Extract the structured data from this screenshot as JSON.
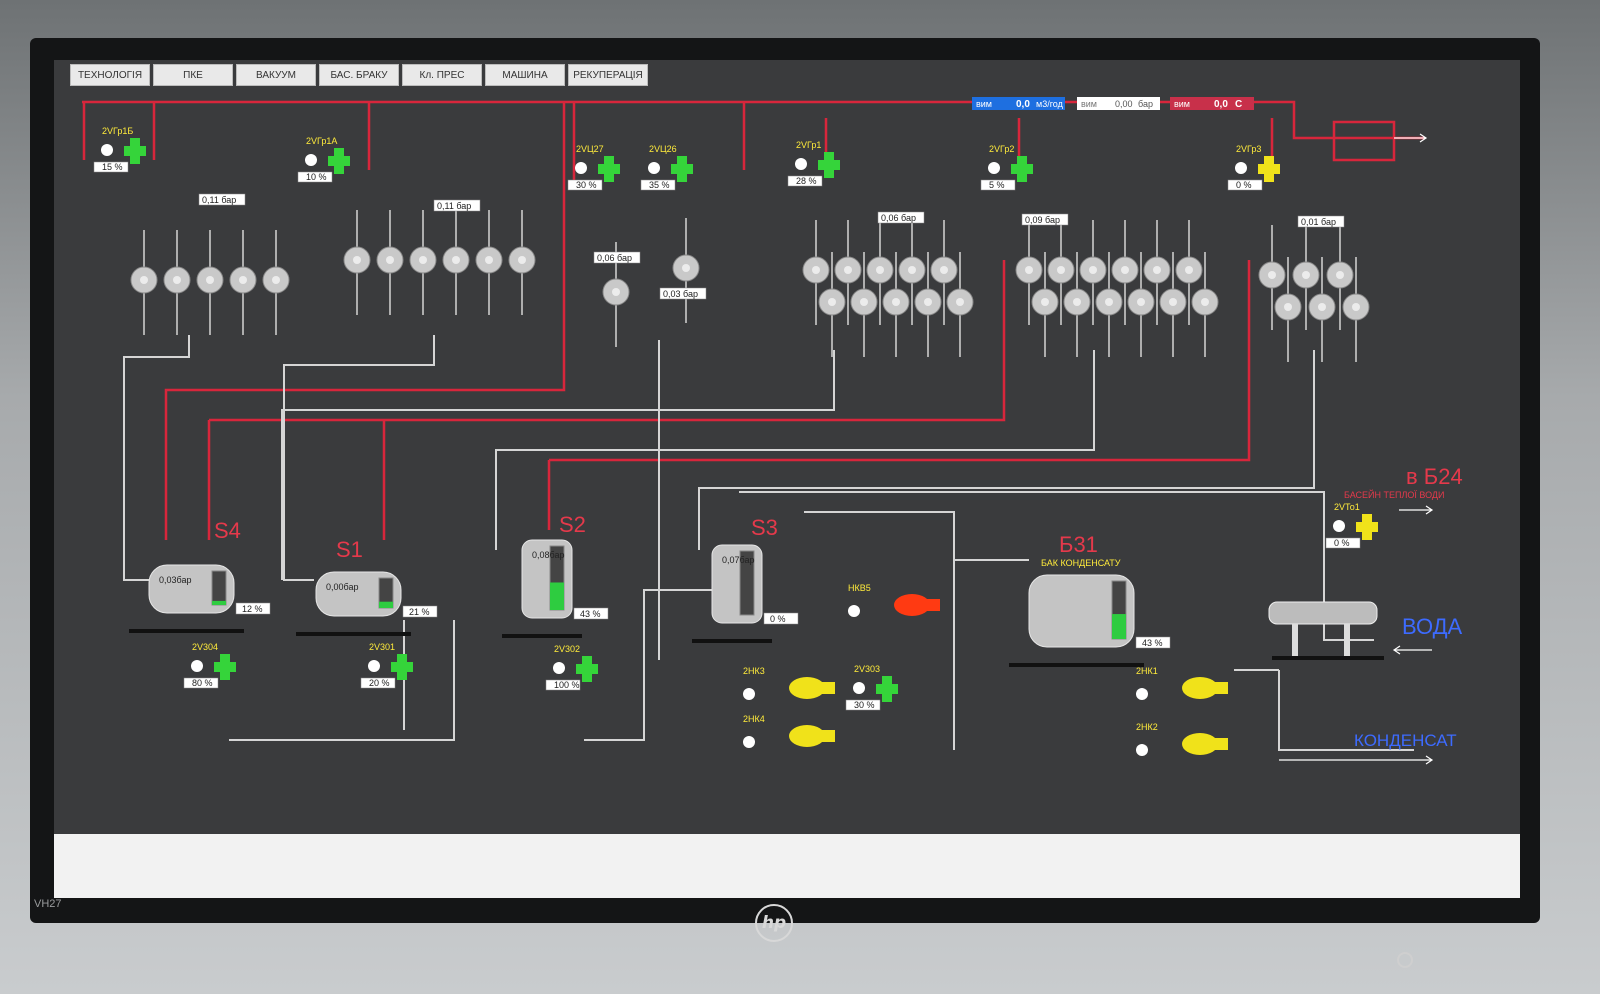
{
  "tabs": [
    "ТЕХНОЛОГІЯ",
    "ПКЕ",
    "ВАКУУМ",
    "БАС. БРАКУ",
    "Кл. ПРЕС",
    "МАШИНА",
    "РЕКУПЕРАЦІЯ"
  ],
  "meters": [
    {
      "prefix": "вим",
      "value": "0,0",
      "unit": "м3/год",
      "color": "#1e6fe0"
    },
    {
      "prefix": "вим",
      "value": "0,00",
      "unit": "бар",
      "color": "#ffffff"
    },
    {
      "prefix": "вим",
      "value": "0,0",
      "unit": "С",
      "color": "#c8304a"
    }
  ],
  "valves": [
    {
      "tag": "2VГр1Б",
      "pct": "15 %"
    },
    {
      "tag": "2VГр1А",
      "pct": "10 %"
    },
    {
      "tag": "2VЦ27",
      "pct": "30 %"
    },
    {
      "tag": "2VЦ26",
      "pct": "35 %"
    },
    {
      "tag": "2VГр1",
      "pct": "28 %"
    },
    {
      "tag": "2VГр2",
      "pct": "5 %"
    },
    {
      "tag": "2VГр3",
      "pct": "0 %"
    },
    {
      "tag": "2VТо1",
      "pct": "0 %"
    },
    {
      "tag": "2V304",
      "pct": "80 %"
    },
    {
      "tag": "2V301",
      "pct": "20 %"
    },
    {
      "tag": "2V302",
      "pct": "100 %"
    },
    {
      "tag": "2V303",
      "pct": "30 %"
    }
  ],
  "pressures": [
    "0,11 бар",
    "0,11 бар",
    "0,06 бар",
    "0,03 бар",
    "0,06 бар",
    "0,09 бар",
    "0,01 бар"
  ],
  "tanks": [
    {
      "name": "S4",
      "pressure": "0,03бар",
      "level": "12 %",
      "level_frac": 0.12
    },
    {
      "name": "S1",
      "pressure": "0,00бар",
      "level": "21 %",
      "level_frac": 0.21
    },
    {
      "name": "S2",
      "pressure": "0,08бар",
      "level": "43 %",
      "level_frac": 0.43
    },
    {
      "name": "S3",
      "pressure": "0,07бар",
      "level": "0 %",
      "level_frac": 0.0
    },
    {
      "name": "Б31",
      "subtitle": "БАК КОНДЕНСАТУ",
      "level": "43 %",
      "level_frac": 0.43
    }
  ],
  "pumps": [
    "2НК3",
    "2НК4",
    "НКВ5",
    "2НК1",
    "2НК2"
  ],
  "destinations": {
    "pool": "в Б24",
    "pool_sub": "БАСЕЙН ТЕПЛОЇ ВОДИ",
    "water": "ВОДА",
    "condensate": "КОНДЕНСАТ"
  },
  "monitor": {
    "model": "VH27",
    "brand": "hp"
  }
}
